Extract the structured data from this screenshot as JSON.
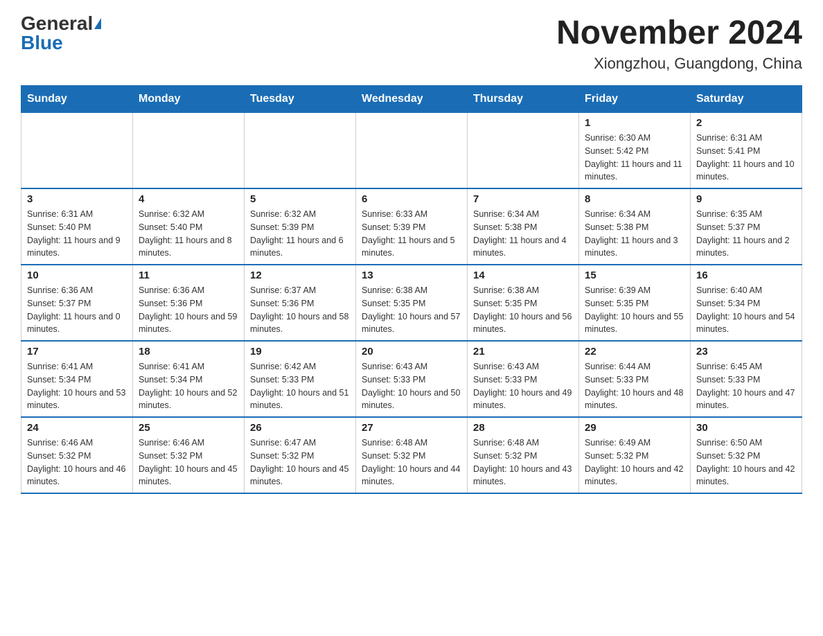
{
  "header": {
    "logo_general": "General",
    "logo_blue": "Blue",
    "month_title": "November 2024",
    "location": "Xiongzhou, Guangdong, China"
  },
  "days_of_week": [
    "Sunday",
    "Monday",
    "Tuesday",
    "Wednesday",
    "Thursday",
    "Friday",
    "Saturday"
  ],
  "weeks": [
    {
      "days": [
        {
          "number": "",
          "info": ""
        },
        {
          "number": "",
          "info": ""
        },
        {
          "number": "",
          "info": ""
        },
        {
          "number": "",
          "info": ""
        },
        {
          "number": "",
          "info": ""
        },
        {
          "number": "1",
          "info": "Sunrise: 6:30 AM\nSunset: 5:42 PM\nDaylight: 11 hours and 11 minutes."
        },
        {
          "number": "2",
          "info": "Sunrise: 6:31 AM\nSunset: 5:41 PM\nDaylight: 11 hours and 10 minutes."
        }
      ]
    },
    {
      "days": [
        {
          "number": "3",
          "info": "Sunrise: 6:31 AM\nSunset: 5:40 PM\nDaylight: 11 hours and 9 minutes."
        },
        {
          "number": "4",
          "info": "Sunrise: 6:32 AM\nSunset: 5:40 PM\nDaylight: 11 hours and 8 minutes."
        },
        {
          "number": "5",
          "info": "Sunrise: 6:32 AM\nSunset: 5:39 PM\nDaylight: 11 hours and 6 minutes."
        },
        {
          "number": "6",
          "info": "Sunrise: 6:33 AM\nSunset: 5:39 PM\nDaylight: 11 hours and 5 minutes."
        },
        {
          "number": "7",
          "info": "Sunrise: 6:34 AM\nSunset: 5:38 PM\nDaylight: 11 hours and 4 minutes."
        },
        {
          "number": "8",
          "info": "Sunrise: 6:34 AM\nSunset: 5:38 PM\nDaylight: 11 hours and 3 minutes."
        },
        {
          "number": "9",
          "info": "Sunrise: 6:35 AM\nSunset: 5:37 PM\nDaylight: 11 hours and 2 minutes."
        }
      ]
    },
    {
      "days": [
        {
          "number": "10",
          "info": "Sunrise: 6:36 AM\nSunset: 5:37 PM\nDaylight: 11 hours and 0 minutes."
        },
        {
          "number": "11",
          "info": "Sunrise: 6:36 AM\nSunset: 5:36 PM\nDaylight: 10 hours and 59 minutes."
        },
        {
          "number": "12",
          "info": "Sunrise: 6:37 AM\nSunset: 5:36 PM\nDaylight: 10 hours and 58 minutes."
        },
        {
          "number": "13",
          "info": "Sunrise: 6:38 AM\nSunset: 5:35 PM\nDaylight: 10 hours and 57 minutes."
        },
        {
          "number": "14",
          "info": "Sunrise: 6:38 AM\nSunset: 5:35 PM\nDaylight: 10 hours and 56 minutes."
        },
        {
          "number": "15",
          "info": "Sunrise: 6:39 AM\nSunset: 5:35 PM\nDaylight: 10 hours and 55 minutes."
        },
        {
          "number": "16",
          "info": "Sunrise: 6:40 AM\nSunset: 5:34 PM\nDaylight: 10 hours and 54 minutes."
        }
      ]
    },
    {
      "days": [
        {
          "number": "17",
          "info": "Sunrise: 6:41 AM\nSunset: 5:34 PM\nDaylight: 10 hours and 53 minutes."
        },
        {
          "number": "18",
          "info": "Sunrise: 6:41 AM\nSunset: 5:34 PM\nDaylight: 10 hours and 52 minutes."
        },
        {
          "number": "19",
          "info": "Sunrise: 6:42 AM\nSunset: 5:33 PM\nDaylight: 10 hours and 51 minutes."
        },
        {
          "number": "20",
          "info": "Sunrise: 6:43 AM\nSunset: 5:33 PM\nDaylight: 10 hours and 50 minutes."
        },
        {
          "number": "21",
          "info": "Sunrise: 6:43 AM\nSunset: 5:33 PM\nDaylight: 10 hours and 49 minutes."
        },
        {
          "number": "22",
          "info": "Sunrise: 6:44 AM\nSunset: 5:33 PM\nDaylight: 10 hours and 48 minutes."
        },
        {
          "number": "23",
          "info": "Sunrise: 6:45 AM\nSunset: 5:33 PM\nDaylight: 10 hours and 47 minutes."
        }
      ]
    },
    {
      "days": [
        {
          "number": "24",
          "info": "Sunrise: 6:46 AM\nSunset: 5:32 PM\nDaylight: 10 hours and 46 minutes."
        },
        {
          "number": "25",
          "info": "Sunrise: 6:46 AM\nSunset: 5:32 PM\nDaylight: 10 hours and 45 minutes."
        },
        {
          "number": "26",
          "info": "Sunrise: 6:47 AM\nSunset: 5:32 PM\nDaylight: 10 hours and 45 minutes."
        },
        {
          "number": "27",
          "info": "Sunrise: 6:48 AM\nSunset: 5:32 PM\nDaylight: 10 hours and 44 minutes."
        },
        {
          "number": "28",
          "info": "Sunrise: 6:48 AM\nSunset: 5:32 PM\nDaylight: 10 hours and 43 minutes."
        },
        {
          "number": "29",
          "info": "Sunrise: 6:49 AM\nSunset: 5:32 PM\nDaylight: 10 hours and 42 minutes."
        },
        {
          "number": "30",
          "info": "Sunrise: 6:50 AM\nSunset: 5:32 PM\nDaylight: 10 hours and 42 minutes."
        }
      ]
    }
  ]
}
